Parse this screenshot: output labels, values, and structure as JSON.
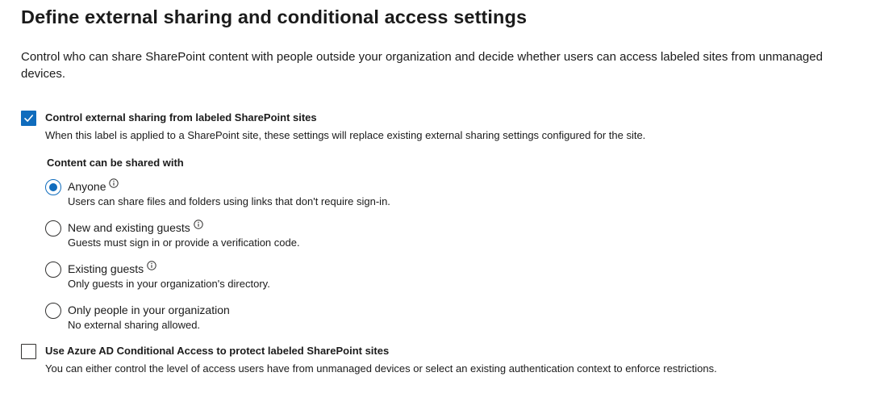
{
  "page": {
    "title": "Define external sharing and conditional access settings",
    "description": "Control who can share SharePoint content with people outside your organization and decide whether users can access labeled sites from unmanaged devices."
  },
  "external_sharing": {
    "checked": true,
    "label": "Control external sharing from labeled SharePoint sites",
    "description": "When this label is applied to a SharePoint site, these settings will replace existing external sharing settings configured for the site.",
    "content_shared_label": "Content can be shared with",
    "options": [
      {
        "label": "Anyone",
        "description": "Users can share files and folders using links that don't require sign-in.",
        "selected": true,
        "has_info_icon": true
      },
      {
        "label": "New and existing guests",
        "description": "Guests must sign in or provide a verification code.",
        "selected": false,
        "has_info_icon": true
      },
      {
        "label": "Existing guests",
        "description": "Only guests in your organization's directory.",
        "selected": false,
        "has_info_icon": true
      },
      {
        "label": "Only people in your organization",
        "description": "No external sharing allowed.",
        "selected": false,
        "has_info_icon": false
      }
    ]
  },
  "conditional_access": {
    "checked": false,
    "label": "Use Azure AD Conditional Access to protect labeled SharePoint sites",
    "description": "You can either control the level of access users have from unmanaged devices or select an existing authentication context to enforce restrictions."
  },
  "colors": {
    "accent": "#0f6cbd",
    "text": "#1b1b1b",
    "border": "#323130"
  }
}
